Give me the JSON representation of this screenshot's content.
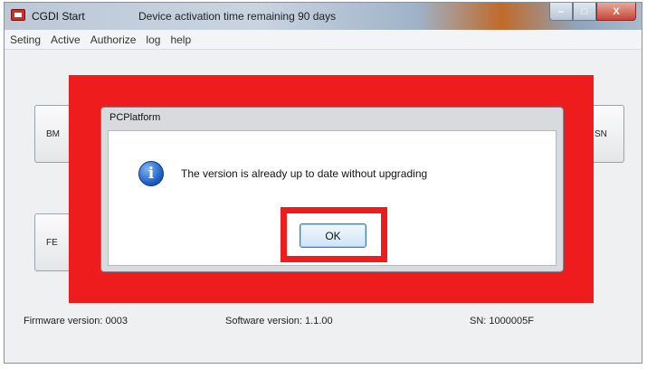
{
  "window": {
    "title": "CGDI Start",
    "notice": "Device activation time remaining 90 days",
    "controls": {
      "minimize": "–",
      "maximize": "□",
      "close": "X"
    }
  },
  "menu": [
    "Seting",
    "Active",
    "Authorize",
    "log",
    "help"
  ],
  "main_buttons": {
    "top_left": "BM",
    "bottom_left": "FE",
    "top_right": "SN"
  },
  "dialog": {
    "title": "PCPlatform",
    "icon": "info-icon",
    "icon_glyph": "i",
    "message": "The version is already up to date without upgrading",
    "ok_label": "OK"
  },
  "status": {
    "firmware": "Firmware version: 0003",
    "software": "Software version:  1.1.00",
    "sn": "SN:  1000005F"
  },
  "colors": {
    "highlight": "#ee1c1c",
    "ok_border": "#3c7fb1",
    "info_icon": "#1d5fc4"
  }
}
